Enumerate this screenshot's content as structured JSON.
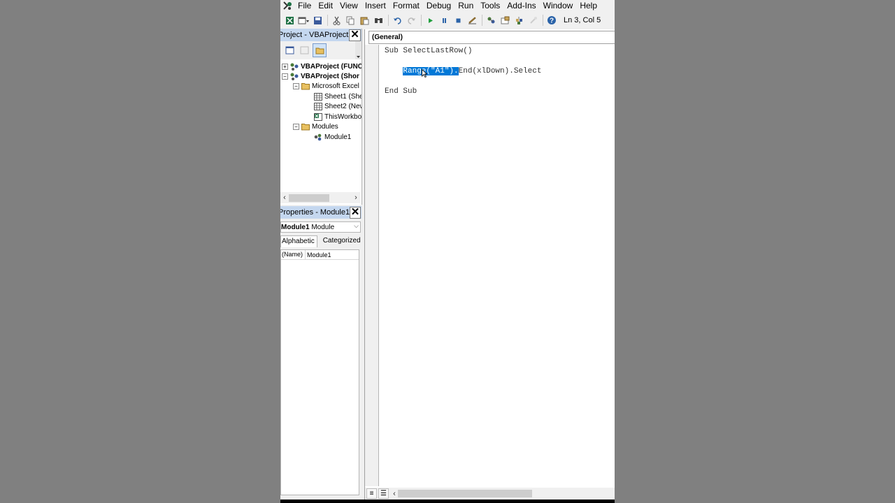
{
  "menu": [
    "File",
    "Edit",
    "View",
    "Insert",
    "Format",
    "Debug",
    "Run",
    "Tools",
    "Add-Ins",
    "Window",
    "Help"
  ],
  "toolbar": {
    "status": "Ln 3, Col 5"
  },
  "project_explorer": {
    "title": "Project - VBAProject",
    "tree": [
      {
        "label": "VBAProject (FUNC",
        "bold": true
      },
      {
        "label": "VBAProject (Shor",
        "bold": true
      },
      {
        "label": "Microsoft Excel"
      },
      {
        "label": "Sheet1 (She"
      },
      {
        "label": "Sheet2 (New"
      },
      {
        "label": "ThisWorkbo"
      },
      {
        "label": "Modules"
      },
      {
        "label": "Module1"
      }
    ]
  },
  "properties": {
    "title": "Properties - Module1",
    "object_name": "Module1",
    "object_type": "Module",
    "tabs": [
      "Alphabetic",
      "Categorized"
    ],
    "rows": [
      {
        "name": "(Name)",
        "value": "Module1"
      }
    ]
  },
  "code": {
    "object_combo": "(General)",
    "lines": {
      "l1": "Sub SelectLastRow()",
      "l2_indent": "    ",
      "l2_selected": "Range(\"A1\").",
      "l2_rest": "End(xlDown).Select",
      "l3": "End Sub"
    }
  },
  "colors": {
    "selection": "#0078d7",
    "title_bar": "#c4d7ef",
    "background": "#808080"
  }
}
